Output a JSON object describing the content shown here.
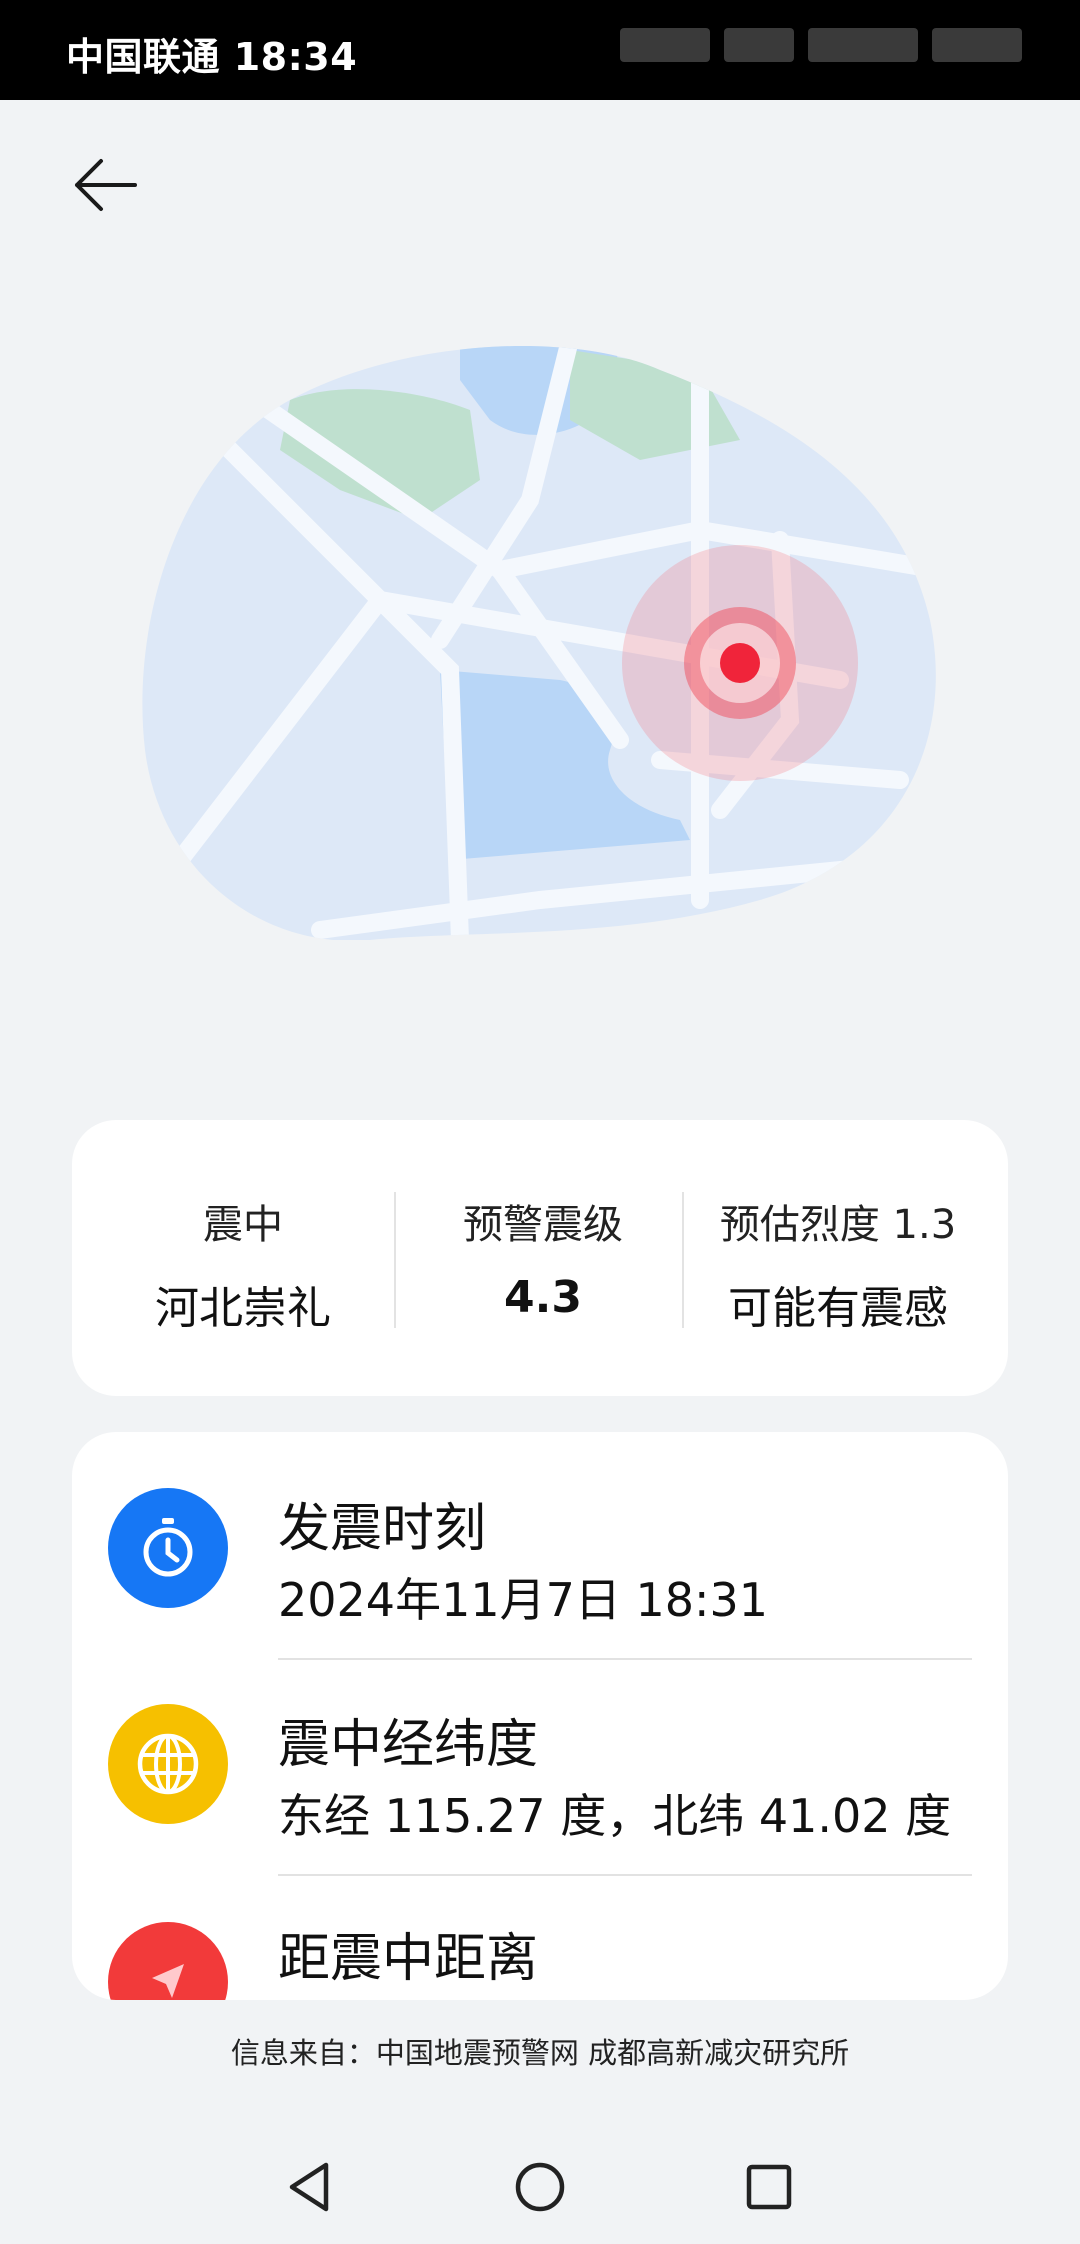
{
  "status_bar": {
    "carrier_time": "中国联通 18:34"
  },
  "header": {
    "back_icon": "arrow-left-icon"
  },
  "summary": {
    "epicenter_label": "震中",
    "epicenter_value": "河北崇礼",
    "magnitude_label": "预警震级",
    "magnitude_value": "4.3",
    "intensity_label": "预估烈度 1.3",
    "intensity_value": "可能有震感"
  },
  "details": [
    {
      "icon": "clock-icon",
      "color": "#1677f5",
      "title": "发震时刻",
      "value": "2024年11月7日 18:31"
    },
    {
      "icon": "globe-icon",
      "color": "#f6c000",
      "title": "震中经纬度",
      "value": "东经 115.27 度，北纬 41.02 度"
    },
    {
      "icon": "navigation-arrow-icon",
      "color": "#f23a3a",
      "title": "距震中距离",
      "value": ""
    }
  ],
  "footer": {
    "source": "信息来自：中国地震预警网 成都高新减灾研究所"
  },
  "nav": {
    "back": "triangle-back-icon",
    "home": "circle-home-icon",
    "recents": "square-recents-icon"
  },
  "colors": {
    "background": "#f1f3f5",
    "map_land": "#dde8f7",
    "map_water": "#b8d6f7",
    "map_park": "#bfe0cf",
    "epicenter": "#f0243a"
  }
}
